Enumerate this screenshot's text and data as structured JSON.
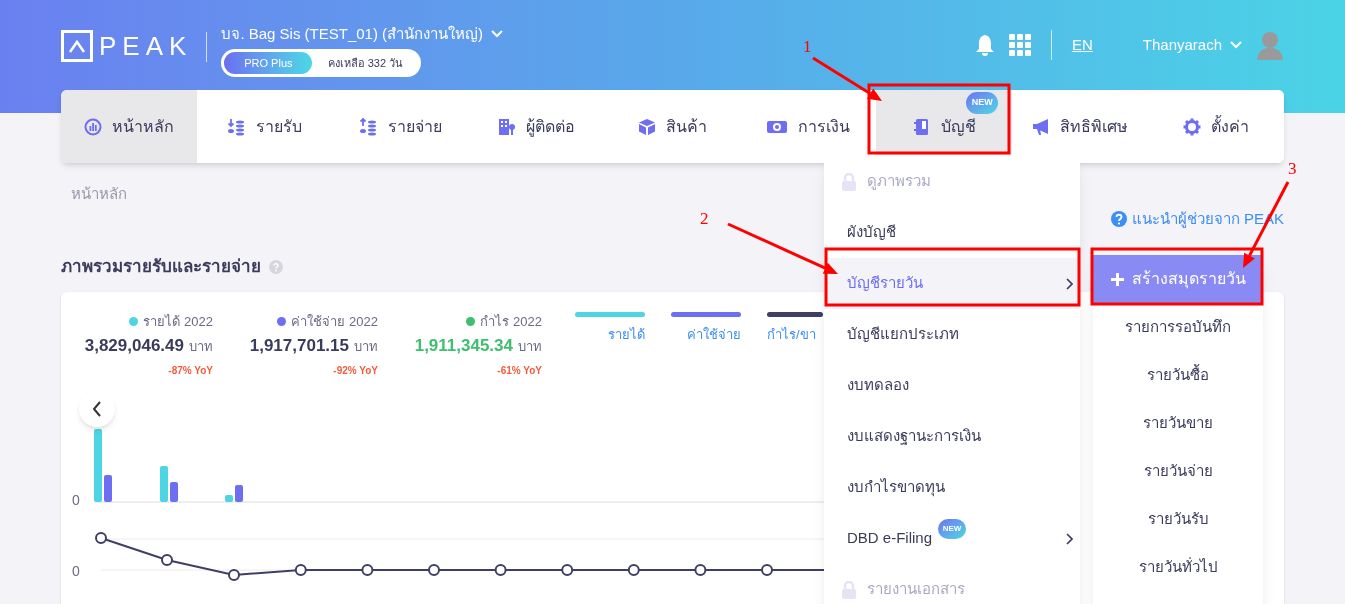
{
  "header": {
    "logo": "PEAK",
    "company": "บจ. Bag Sis (TEST_01) (สำนักงานใหญ่)",
    "plan": "PRO Plus",
    "remaining": "คงเหลือ 332 วัน",
    "language": "EN",
    "user": "Thanyarach"
  },
  "nav_tabs": [
    {
      "label": "หน้าหลัก",
      "selected": true
    },
    {
      "label": "รายรับ",
      "selected": false
    },
    {
      "label": "รายจ่าย",
      "selected": false
    },
    {
      "label": "ผู้ติดต่อ",
      "selected": false
    },
    {
      "label": "สินค้า",
      "selected": false
    },
    {
      "label": "การเงิน",
      "selected": false
    },
    {
      "label": "บัญชี",
      "selected": true,
      "badge": "NEW"
    },
    {
      "label": "สิทธิพิเศษ",
      "selected": false
    },
    {
      "label": "ตั้งค่า",
      "selected": false
    }
  ],
  "breadcrumb": "หน้าหลัก",
  "help_link": "แนะนำผู้ช่วยจาก PEAK",
  "section_title": "ภาพรวมรายรับและรายจ่าย",
  "summary": [
    {
      "label": "รายได้ 2022",
      "color": "#4dd5e3",
      "amount": "3,829,046.49",
      "unit": "บาท",
      "change": "-87% YoY",
      "highlight": false
    },
    {
      "label": "ค่าใช้จ่าย 2022",
      "color": "#6e6ef2",
      "amount": "1,917,701.15",
      "unit": "บาท",
      "change": "-92% YoY",
      "highlight": false
    },
    {
      "label": "กำไร 2022",
      "color": "#3fbf6e",
      "amount": "1,911,345.34",
      "unit": "บาท",
      "change": "-61% YoY",
      "highlight": true
    }
  ],
  "legend": [
    {
      "label": "รายได้",
      "color": "#4dd5e3"
    },
    {
      "label": "ค่าใช้จ่าย",
      "color": "#6e6ef2"
    },
    {
      "label": "กำไร/ขา",
      "color": "#3f3f66"
    }
  ],
  "chart": {
    "bar_axis_label": "0",
    "line_axis_label": "0"
  },
  "menu": {
    "items": [
      {
        "label": "ดูภาพรวม",
        "locked": true,
        "selected": false,
        "has_submenu": false
      },
      {
        "label": "ผังบัญชี",
        "locked": false,
        "selected": false,
        "has_submenu": false
      },
      {
        "label": "บัญชีรายวัน",
        "locked": false,
        "selected": true,
        "has_submenu": true
      },
      {
        "label": "บัญชีแยกประเภท",
        "locked": false,
        "selected": false,
        "has_submenu": false
      },
      {
        "label": "งบทดลอง",
        "locked": false,
        "selected": false,
        "has_submenu": false
      },
      {
        "label": "งบแสดงฐานะการเงิน",
        "locked": false,
        "selected": false,
        "has_submenu": false
      },
      {
        "label": "งบกำไรขาดทุน",
        "locked": false,
        "selected": false,
        "has_submenu": false
      },
      {
        "label": "DBD e-Filing",
        "locked": false,
        "selected": false,
        "has_submenu": true,
        "badge": "NEW"
      },
      {
        "label": "รายงานเอกสาร",
        "locked": true,
        "selected": false,
        "has_submenu": false
      }
    ]
  },
  "submenu": {
    "create_button": "สร้างสมุดรายวัน",
    "items": [
      "รายการรอบันทึก",
      "รายวันซื้อ",
      "รายวันขาย",
      "รายวันจ่าย",
      "รายวันรับ",
      "รายวันทั่วไป"
    ]
  },
  "annotations": [
    {
      "number": "1"
    },
    {
      "number": "2"
    },
    {
      "number": "3"
    }
  ]
}
